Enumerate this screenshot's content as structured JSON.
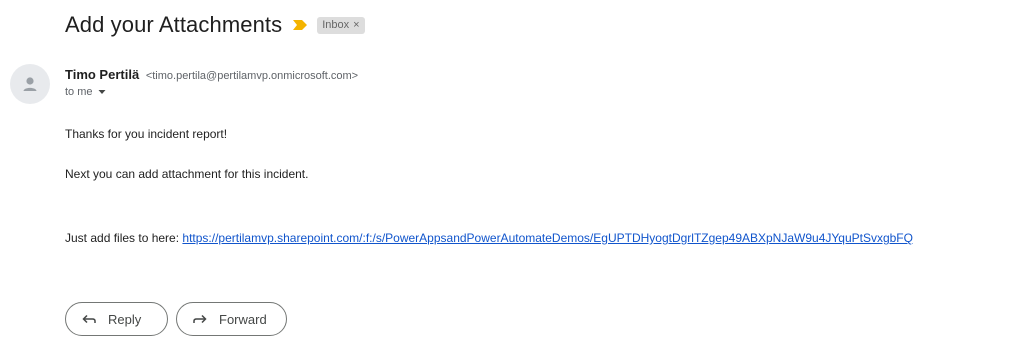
{
  "email": {
    "subject": "Add your Attachments",
    "label": "Inbox",
    "label_close": "×",
    "sender_name": "Timo Pertilä",
    "sender_email": "<timo.pertila@pertilamvp.onmicrosoft.com>",
    "recipient": "to me",
    "body": {
      "line1": "Thanks for you incident report!",
      "line2": "Next you can add attachment for this incident.",
      "line3_prefix": "Just add files to here: ",
      "link": "https://pertilamvp.sharepoint.com/:f:/s/PowerAppsandPowerAutomateDemos/EgUPTDHyogtDgrlTZgep49ABXpNJaW9u4JYquPtSvxgbFQ"
    }
  },
  "actions": {
    "reply_label": "Reply",
    "forward_label": "Forward"
  },
  "icons": {
    "importance": "importance-marker-icon",
    "avatar": "person-avatar-icon",
    "caret": "caret-down-icon",
    "reply": "reply-arrow-icon",
    "forward": "forward-arrow-icon"
  },
  "colors": {
    "importance": "#f4b400",
    "link": "#1155cc",
    "label_bg": "#dddddd"
  }
}
